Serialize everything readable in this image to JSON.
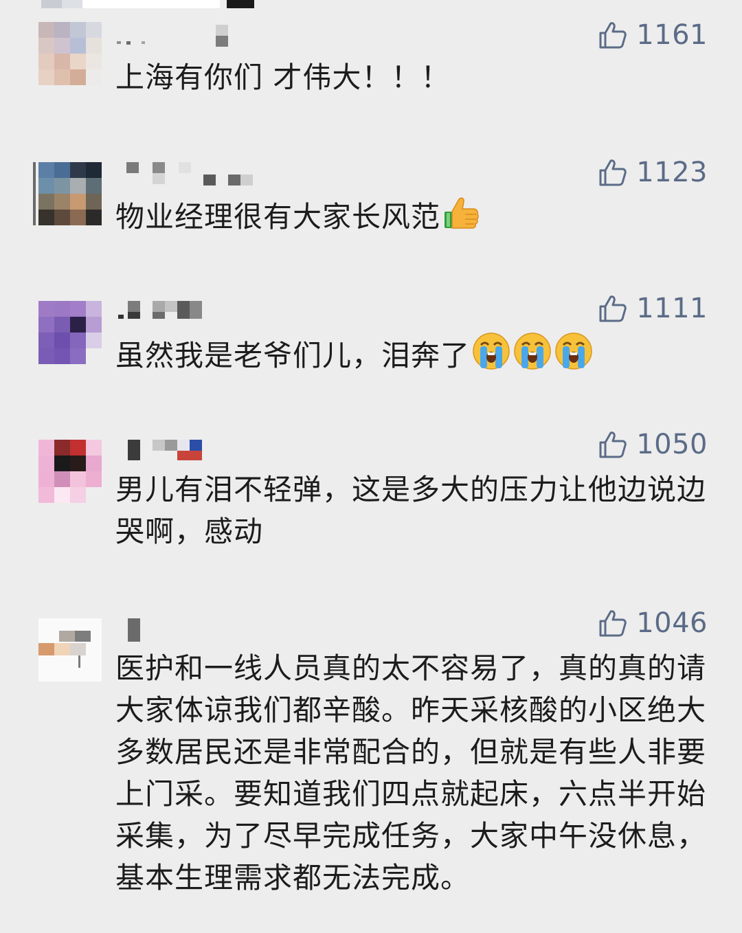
{
  "comments": [
    {
      "likes": "1161",
      "text": "上海有你们 才伟大！！！",
      "emoji": []
    },
    {
      "likes": "1123",
      "text": "物业经理很有大家长风范",
      "emoji": [
        "thumbs-up"
      ]
    },
    {
      "likes": "1111",
      "text": "虽然我是老爷们儿，泪奔了",
      "emoji": [
        "crying-face",
        "crying-face",
        "crying-face"
      ]
    },
    {
      "likes": "1050",
      "text": "男儿有泪不轻弹，这是多大的压力让他边说边哭啊，感动",
      "emoji": []
    },
    {
      "likes": "1046",
      "text": "医护和一线人员真的太不容易了，真的真的请大家体谅我们都辛酸。昨天采核酸的小区绝大多数居民还是非常配合的，但就是有些人非要上门采。要知道我们四点就起床，六点半开始采集，为了尽早完成任务，大家中午没休息，基本生理需求都无法完成。",
      "emoji": []
    }
  ],
  "icons": {
    "like": "thumbs-up-outline-icon"
  },
  "colors": {
    "background": "#ededed",
    "like_count": "#5b6b87",
    "text": "#1c1c1c"
  }
}
